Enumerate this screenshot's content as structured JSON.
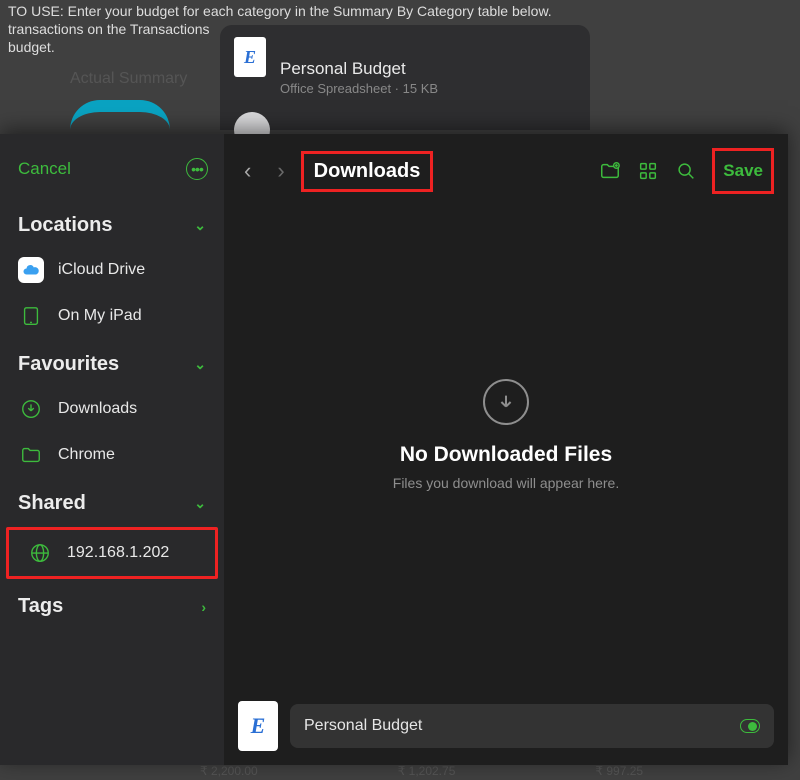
{
  "background": {
    "instructions_line1": "TO USE: Enter your budget for each category in the Summary By Category table below.",
    "instructions_line2": "transactions on the Transactions",
    "instructions_line3": "budget.",
    "section_label": "Actual Summary",
    "values": [
      "₹ 2,200.00",
      "₹ 1,202.75",
      "₹ 997.25"
    ]
  },
  "share_card": {
    "title": "Personal Budget",
    "type": "Office Spreadsheet",
    "size": "15 KB"
  },
  "sidebar": {
    "cancel": "Cancel",
    "sections": {
      "locations": {
        "label": "Locations",
        "items": [
          "iCloud Drive",
          "On My iPad"
        ]
      },
      "favourites": {
        "label": "Favourites",
        "items": [
          "Downloads",
          "Chrome"
        ]
      },
      "shared": {
        "label": "Shared",
        "items": [
          "192.168.1.202"
        ]
      },
      "tags": {
        "label": "Tags"
      }
    }
  },
  "toolbar": {
    "breadcrumb": "Downloads",
    "save": "Save"
  },
  "empty": {
    "title": "No Downloaded Files",
    "sub": "Files you download will appear here."
  },
  "filename": {
    "value": "Personal Budget"
  }
}
